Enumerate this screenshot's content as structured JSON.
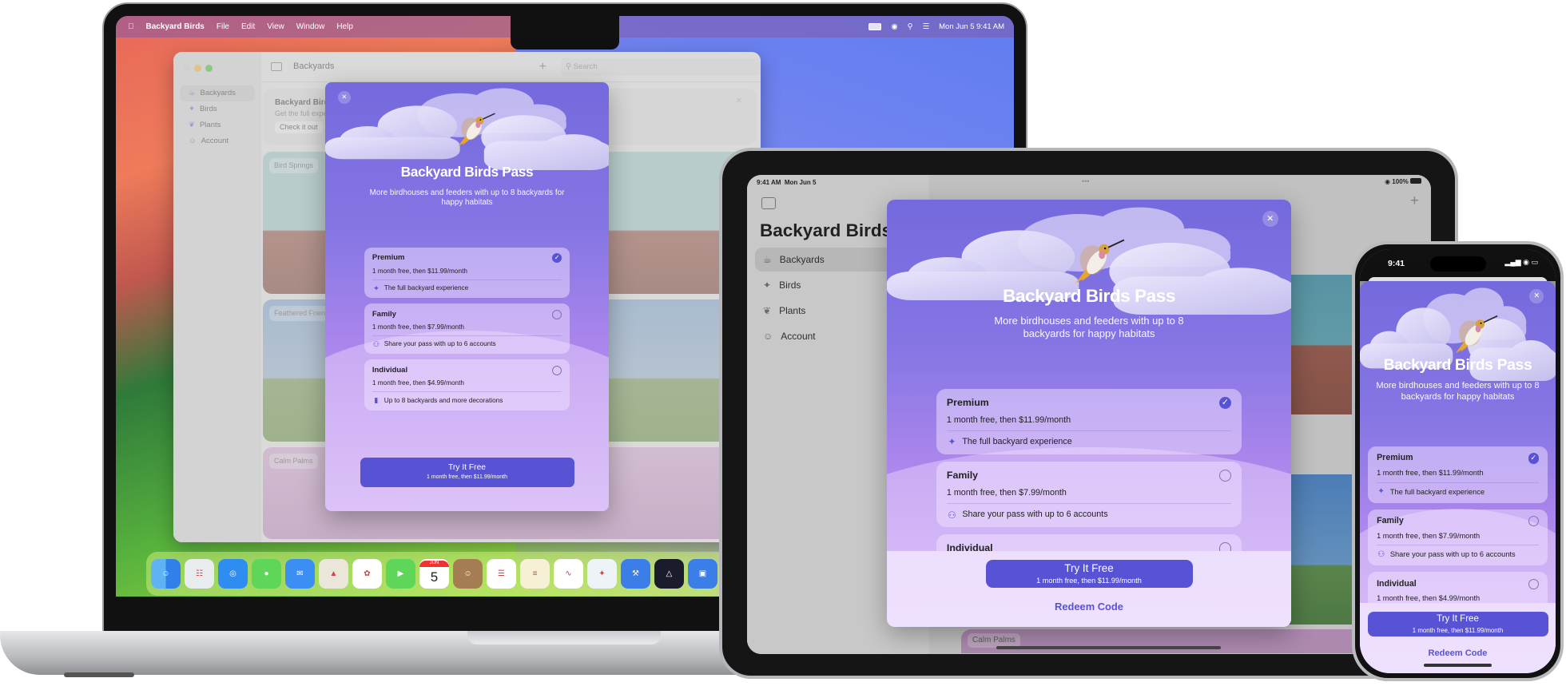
{
  "mac": {
    "menubar": {
      "app_name": "Backyard Birds",
      "menus": [
        "File",
        "Edit",
        "View",
        "Window",
        "Help"
      ],
      "clock": "Mon Jun 5  9:41 AM"
    },
    "window": {
      "toolbar_title": "Backyards",
      "search_placeholder": "Search",
      "sidebar": [
        {
          "label": "Backyards",
          "icon": "birdbath-icon"
        },
        {
          "label": "Birds",
          "icon": "bird-icon"
        },
        {
          "label": "Plants",
          "icon": "leaf-icon"
        },
        {
          "label": "Account",
          "icon": "person-circle-icon"
        }
      ],
      "banner": {
        "title": "Backyard Birds Pass",
        "subtitle": "Get the full experience",
        "button": "Check it out"
      },
      "cards": [
        "Bird Springs",
        "Feathered Friends",
        "Calm Palms"
      ]
    },
    "dock": [
      {
        "name": "finder"
      },
      {
        "name": "launchpad"
      },
      {
        "name": "safari"
      },
      {
        "name": "messages"
      },
      {
        "name": "mail"
      },
      {
        "name": "maps"
      },
      {
        "name": "photos"
      },
      {
        "name": "facetime"
      },
      {
        "name": "calendar",
        "month": "JUN",
        "day": "5"
      },
      {
        "name": "contacts"
      },
      {
        "name": "reminders"
      },
      {
        "name": "notes"
      },
      {
        "name": "freeform"
      },
      {
        "name": "backyard-birds"
      },
      {
        "name": "xcode"
      },
      {
        "name": "instruments"
      },
      {
        "name": "simulator"
      }
    ]
  },
  "ipad": {
    "status": {
      "time": "9:41 AM",
      "date": "Mon Jun 5",
      "battery": "100%"
    },
    "sidebar_title": "Backyard Birds",
    "sidebar": [
      {
        "label": "Backyards"
      },
      {
        "label": "Birds"
      },
      {
        "label": "Plants"
      },
      {
        "label": "Account"
      }
    ],
    "visible_card": "Calm Palms"
  },
  "iphone": {
    "status": {
      "time": "9:41"
    }
  },
  "pass": {
    "title": "Backyard Birds Pass",
    "subtitle": "More birdhouses and feeders with up to 8 backyards for happy habitats",
    "plans": [
      {
        "name": "Premium",
        "price": "1 month free, then $11.99/month",
        "feature": "The full backyard experience",
        "icon": "hummingbird-icon",
        "selected": true
      },
      {
        "name": "Family",
        "price": "1 month free, then $7.99/month",
        "feature": "Share your pass with up to 6 accounts",
        "icon": "people-icon",
        "selected": false
      },
      {
        "name": "Individual",
        "price": "1 month free, then $4.99/month",
        "feature": "Up to 8 backyards and more decorations",
        "icon": "phone-icon",
        "selected": false
      }
    ],
    "cta": {
      "title": "Try It Free",
      "subtitle": "1 month free, then $11.99/month"
    },
    "redeem": "Redeem Code"
  },
  "colors": {
    "accent": "#5753d4",
    "sheet_top": "#7469dd",
    "sheet_bottom": "#caa4f2"
  }
}
